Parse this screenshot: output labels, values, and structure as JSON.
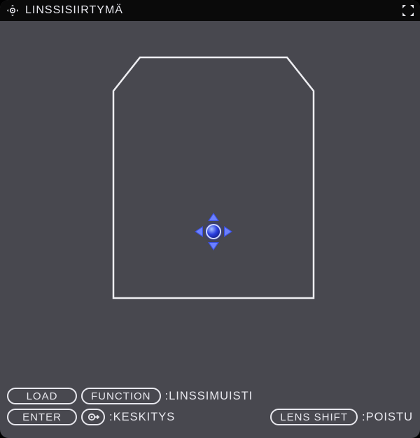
{
  "title": "LINSSISIIRTYMÄ",
  "footer": {
    "row1": {
      "btn1": "LOAD",
      "btn2": "FUNCTION",
      "label2": ":LINSSIMUISTI"
    },
    "row2": {
      "btn1": "ENTER",
      "label1": ":KESKITYS",
      "btn2": "LENS SHIFT",
      "label2": ":POISTU"
    }
  }
}
